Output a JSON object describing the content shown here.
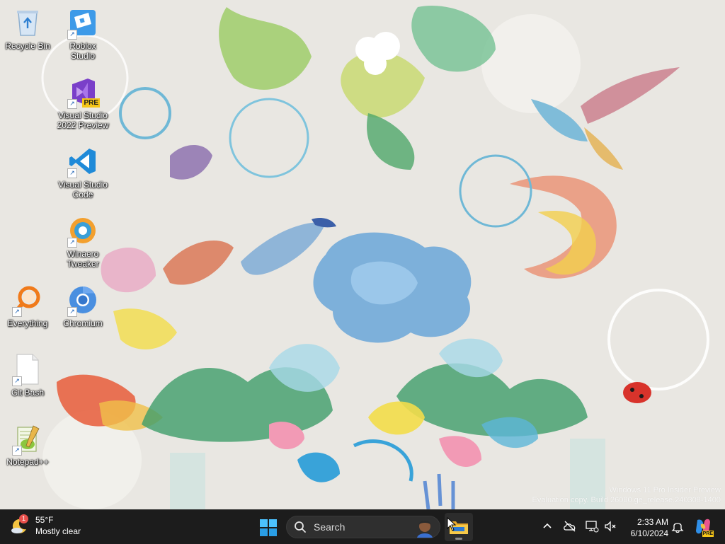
{
  "desktop": {
    "icons": [
      {
        "label": "Recycle Bin"
      },
      {
        "label": "Roblox Studio"
      },
      {
        "label": "Visual Studio 2022 Preview"
      },
      {
        "label": "Visual Studio Code"
      },
      {
        "label": "Winaero Tweaker"
      },
      {
        "label": "Everything"
      },
      {
        "label": "Chromium"
      },
      {
        "label": "Git Bash"
      },
      {
        "label": "Notepad++"
      }
    ],
    "vs_badge": "PRE",
    "watermark": {
      "line1": "Windows 11 Pro Insider Preview",
      "line2": "Evaluation copy. Build 26080.ge_release.240308-1400"
    }
  },
  "taskbar": {
    "weather": {
      "temp": "55°F",
      "condition": "Mostly clear",
      "badge": "1"
    },
    "search": {
      "placeholder": "Search"
    },
    "clock": {
      "time": "2:33 AM",
      "date": "6/10/2024"
    },
    "copilot_badge": "PRE"
  },
  "colors": {
    "taskbar_bg": "#1c1c1c",
    "wallpaper_bg": "#e9e7e2",
    "accent": "#0078d4"
  }
}
